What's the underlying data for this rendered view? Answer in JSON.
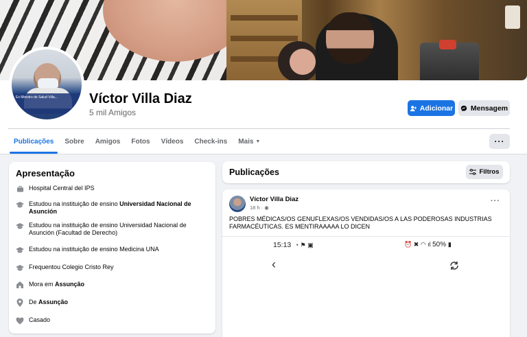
{
  "profile": {
    "name": "Víctor Villa Diaz",
    "friends": "5 mil Amigos",
    "avatar_caption": "Ex Ministro de Salud Villa..."
  },
  "actions": {
    "add_label": "Adicionar",
    "message_label": "Mensagem",
    "more_label": "···"
  },
  "tabs": [
    {
      "label": "Publicações",
      "active": true
    },
    {
      "label": "Sobre"
    },
    {
      "label": "Amigos"
    },
    {
      "label": "Fotos"
    },
    {
      "label": "Vídeos"
    },
    {
      "label": "Check-ins"
    },
    {
      "label": "Mais",
      "caret": "▼"
    }
  ],
  "intro": {
    "title": "Apresentação",
    "items": [
      {
        "icon": "briefcase-icon",
        "text": "Hospital Central del IPS",
        "bold": ""
      },
      {
        "icon": "graduation-cap-icon",
        "text": "Estudou na instituição de ensino ",
        "bold": "Universidad Nacional de Asunción"
      },
      {
        "icon": "graduation-cap-icon",
        "text": "Estudou na instituição de ensino Universidad Nacional de Asunción (Facultad de Derecho)",
        "bold": ""
      },
      {
        "icon": "graduation-cap-icon",
        "text": "Estudou na instituição de ensino Medicina UNA",
        "bold": ""
      },
      {
        "icon": "graduation-cap-icon",
        "text": "Frequentou Colegio Cristo Rey",
        "bold": ""
      },
      {
        "icon": "home-icon",
        "text": "Mora em ",
        "bold": "Assunção"
      },
      {
        "icon": "location-pin-icon",
        "text": "De ",
        "bold": "Assunção"
      },
      {
        "icon": "heart-icon",
        "text": "Casado",
        "bold": ""
      }
    ]
  },
  "posts": {
    "title": "Publicações",
    "filter_label": "Filtros",
    "post": {
      "author": "Víctor Villa Diaz",
      "time": "18 h ·",
      "text": "POBRES MÉDICAS/OS GENUFLEXAS/OS VENDIDAS/OS A LAS PODEROSAS INDUSTRIAS FARMACÉUTICAS. ES MENTIRAAAAA LO DICEN",
      "more": "···",
      "phone": {
        "time": "15:13",
        "battery": "50%"
      }
    }
  }
}
